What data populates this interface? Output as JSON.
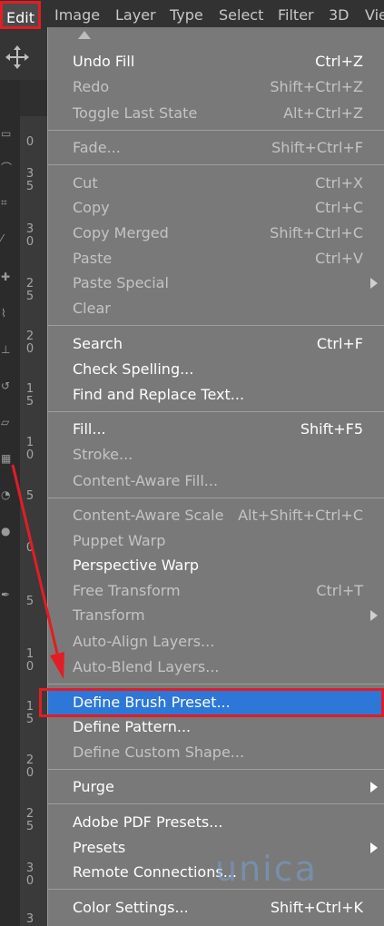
{
  "menubar": {
    "items": [
      "Edit",
      "Image",
      "Layer",
      "Type",
      "Select",
      "Filter",
      "3D",
      "View"
    ]
  },
  "ruler": {
    "marks": [
      "0",
      "35",
      "30",
      "25",
      "20",
      "15",
      "10",
      "5",
      "0",
      "5",
      "10",
      "15",
      "20",
      "25",
      "30",
      "3"
    ]
  },
  "menu": {
    "items": [
      {
        "label": "Undo Fill",
        "shortcut": "Ctrl+Z",
        "enabled": true
      },
      {
        "label": "Redo",
        "shortcut": "Shift+Ctrl+Z",
        "enabled": false
      },
      {
        "label": "Toggle Last State",
        "shortcut": "Alt+Ctrl+Z",
        "enabled": false
      },
      {
        "label": "Fade...",
        "shortcut": "Shift+Ctrl+F",
        "enabled": false
      },
      {
        "label": "Cut",
        "shortcut": "Ctrl+X",
        "enabled": false
      },
      {
        "label": "Copy",
        "shortcut": "Ctrl+C",
        "enabled": false
      },
      {
        "label": "Copy Merged",
        "shortcut": "Shift+Ctrl+C",
        "enabled": false
      },
      {
        "label": "Paste",
        "shortcut": "Ctrl+V",
        "enabled": false
      },
      {
        "label": "Paste Special",
        "shortcut": "",
        "enabled": false,
        "submenu": true
      },
      {
        "label": "Clear",
        "shortcut": "",
        "enabled": false
      },
      {
        "label": "Search",
        "shortcut": "Ctrl+F",
        "enabled": true
      },
      {
        "label": "Check Spelling...",
        "shortcut": "",
        "enabled": true
      },
      {
        "label": "Find and Replace Text...",
        "shortcut": "",
        "enabled": true
      },
      {
        "label": "Fill...",
        "shortcut": "Shift+F5",
        "enabled": true
      },
      {
        "label": "Stroke...",
        "shortcut": "",
        "enabled": false
      },
      {
        "label": "Content-Aware Fill...",
        "shortcut": "",
        "enabled": false
      },
      {
        "label": "Content-Aware Scale",
        "shortcut": "Alt+Shift+Ctrl+C",
        "enabled": false
      },
      {
        "label": "Puppet Warp",
        "shortcut": "",
        "enabled": false
      },
      {
        "label": "Perspective Warp",
        "shortcut": "",
        "enabled": true
      },
      {
        "label": "Free Transform",
        "shortcut": "Ctrl+T",
        "enabled": false
      },
      {
        "label": "Transform",
        "shortcut": "",
        "enabled": false,
        "submenu": true
      },
      {
        "label": "Auto-Align Layers...",
        "shortcut": "",
        "enabled": false
      },
      {
        "label": "Auto-Blend Layers...",
        "shortcut": "",
        "enabled": false
      },
      {
        "label": "Define Brush Preset...",
        "shortcut": "",
        "enabled": true,
        "highlighted": true
      },
      {
        "label": "Define Pattern...",
        "shortcut": "",
        "enabled": true
      },
      {
        "label": "Define Custom Shape...",
        "shortcut": "",
        "enabled": false
      },
      {
        "label": "Purge",
        "shortcut": "",
        "enabled": true,
        "submenu": true
      },
      {
        "label": "Adobe PDF Presets...",
        "shortcut": "",
        "enabled": true
      },
      {
        "label": "Presets",
        "shortcut": "",
        "enabled": true,
        "submenu": true
      },
      {
        "label": "Remote Connections...",
        "shortcut": "",
        "enabled": true
      },
      {
        "label": "Color Settings...",
        "shortcut": "Shift+Ctrl+K",
        "enabled": true
      }
    ]
  },
  "watermark": {
    "text": "unica"
  },
  "colors": {
    "highlight": "#2c77d8",
    "annotation_red": "#e41c24",
    "menu_bg": "#797979",
    "menubar_bg": "#323232"
  },
  "icons": {
    "move_tool": "move-arrows-icon",
    "menu_caret": "caret-up-icon",
    "submenu": "chevron-right-icon"
  }
}
